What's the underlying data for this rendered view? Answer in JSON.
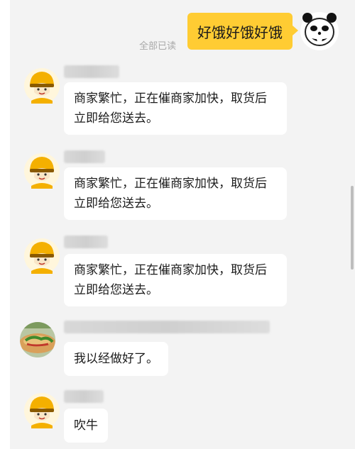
{
  "outgoing": {
    "text": "好饿好饿好饿",
    "read_status": "全部已读",
    "avatar_icon": "panda-meme-avatar-icon"
  },
  "incoming": [
    {
      "avatar_icon": "courier-avatar-icon",
      "text": "商家繁忙，正在催商家加快，取货后立即给您送去。"
    },
    {
      "avatar_icon": "courier-avatar-icon",
      "text": "商家繁忙，正在催商家加快，取货后立即给您送去。"
    },
    {
      "avatar_icon": "courier-avatar-icon",
      "text": "商家繁忙，正在催商家加快，取货后立即给您送去。"
    },
    {
      "avatar_icon": "food-photo-avatar-icon",
      "text": "我以经做好了。"
    },
    {
      "avatar_icon": "courier-avatar-icon",
      "text": "吹牛"
    }
  ],
  "colors": {
    "outgoing_bubble": "#ffcc33",
    "chat_background": "#f3f3f3",
    "incoming_bubble": "#ffffff",
    "courier_helmet": "#f4b000"
  }
}
